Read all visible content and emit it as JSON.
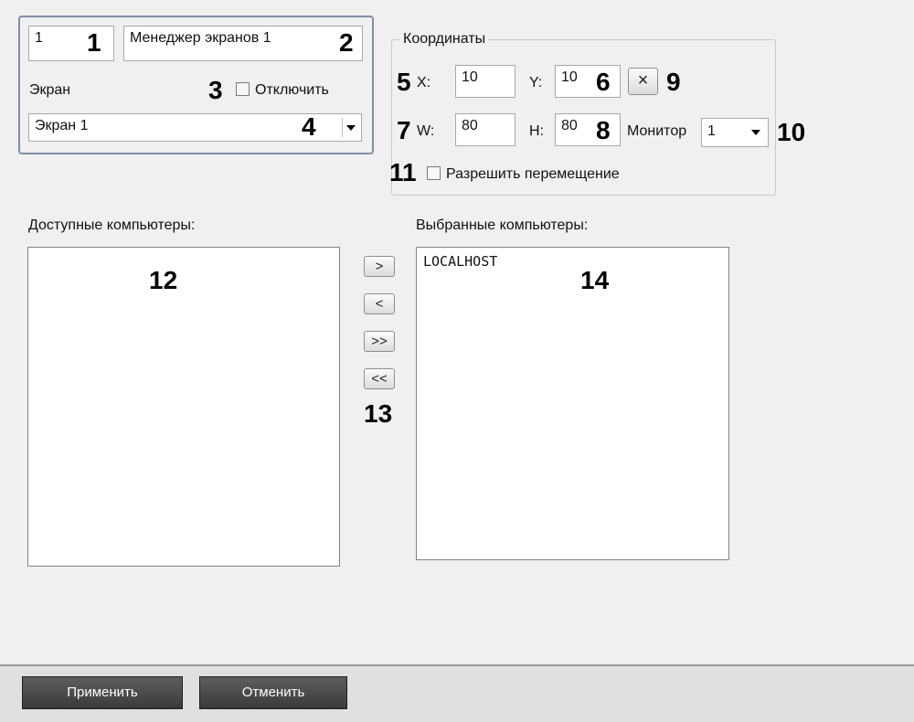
{
  "header": {
    "id_value": "1",
    "name_value": "Менеджер экранов 1",
    "screen_label": "Экран",
    "disable_label": "Отключить",
    "screen_select_value": "Экран 1"
  },
  "coords": {
    "legend": "Координаты",
    "x_label": "X:",
    "x_value": "10",
    "y_label": "Y:",
    "y_value": "10",
    "w_label": "W:",
    "w_value": "80",
    "h_label": "H:",
    "h_value": "80",
    "reset_label": "×",
    "monitor_label": "Монитор",
    "monitor_value": "1",
    "allow_move_label": "Разрешить перемещение"
  },
  "lists": {
    "available_label": "Доступные компьютеры:",
    "selected_label": "Выбранные компьютеры:",
    "available_items": [],
    "selected_items": [
      "LOCALHOST"
    ]
  },
  "transfer": {
    "add_label": ">",
    "remove_label": "<",
    "add_all_label": ">>",
    "remove_all_label": "<<"
  },
  "callouts": [
    "1",
    "2",
    "3",
    "4",
    "5",
    "6",
    "7",
    "8",
    "9",
    "10",
    "11",
    "12",
    "13",
    "14"
  ],
  "footer": {
    "apply_label": "Применить",
    "cancel_label": "Отменить"
  }
}
